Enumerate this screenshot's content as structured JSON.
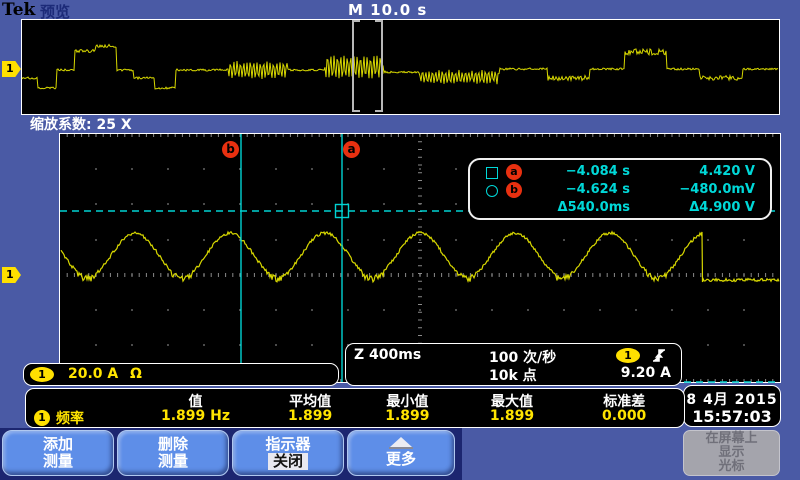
{
  "header": {
    "brand": "Tek",
    "mode": "预览",
    "timebase": "M 10.0 s"
  },
  "zoom_bar": {
    "label": "缩放系数: 25 X"
  },
  "overview": {
    "channel_badge": "1"
  },
  "main": {
    "channel_badge": "1"
  },
  "cursors": {
    "a": {
      "label": "a",
      "time": "−4.084 s",
      "value": "4.420 V"
    },
    "b": {
      "label": "b",
      "time": "−4.624 s",
      "value": "−480.0mV"
    },
    "delta_time": "Δ540.0ms",
    "delta_value": "Δ4.900 V"
  },
  "channel_box": {
    "badge": "1",
    "scale": "20.0 A",
    "coupling": "Ω"
  },
  "acquisition": {
    "zoom_timebase": "Z 400ms",
    "waveform_rate": "100 次/秒",
    "record_length": "10k 点",
    "trigger_badge": "1",
    "trigger_level": "9.20 A"
  },
  "datetime": {
    "date": "8 4月 2015",
    "time": "15:57:03"
  },
  "measurements": {
    "headers": [
      "值",
      "平均值",
      "最小值",
      "最大值",
      "标准差"
    ],
    "rows": [
      {
        "badge": "1",
        "name": "频率",
        "value": "1.899 Hz",
        "mean": "1.899",
        "min": "1.899",
        "max": "1.899",
        "stddev": "0.000"
      }
    ]
  },
  "menu": {
    "add": {
      "line1": "添加",
      "line2": "测量"
    },
    "delete": {
      "line1": "删除",
      "line2": "测量"
    },
    "indicator": {
      "line1": "指示器",
      "line2": "关闭"
    },
    "more": {
      "label": "更多"
    },
    "cursor_onscreen": {
      "line1": "在屏幕上",
      "line2": "显示",
      "line3": "光标"
    }
  },
  "colors": {
    "body_blue": "#4a5aa5",
    "waveform_yellow": "#d8d800",
    "cursor_cyan": "#00d2d2",
    "marker_red": "#e83010",
    "trigger_orange": "#ffa000",
    "text_yellow": "#ffe400",
    "menu_button_blue": "#5e8ee8"
  }
}
